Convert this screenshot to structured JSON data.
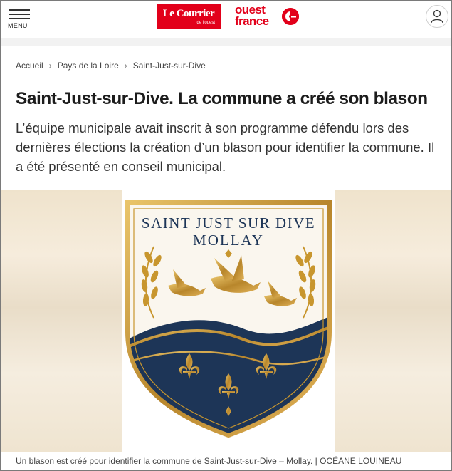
{
  "header": {
    "menu_label": "MENU",
    "logo_courrier_main": "Le Courrier",
    "logo_courrier_sub": "de l'ouest",
    "logo_ouest_france_line1": "ouest",
    "logo_ouest_france_line2": "france",
    "account_icon": "user-icon"
  },
  "breadcrumb": {
    "items": [
      "Accueil",
      "Pays de la Loire",
      "Saint-Just-sur-Dive"
    ],
    "separator_icon": "chevron-right-icon"
  },
  "article": {
    "title": "Saint-Just-sur-Dive. La commune a créé son blason",
    "lead": "L’équipe municipale avait inscrit à son programme défendu lors des dernières élections la création d’un blason pour identifier la commune. Il a été présenté en conseil municipal.",
    "image": {
      "crest_line1": "SAINT JUST SUR DIVE",
      "crest_line2": "MOLLAY",
      "caption": "Un blason est créé pour identifier la commune de Saint-Just-sur-Dive – Mollay. | OCÉANE LOUINEAU"
    }
  },
  "colors": {
    "brand_red": "#e2001a",
    "crest_navy": "#1d3557",
    "crest_gold": "#c8962e"
  }
}
